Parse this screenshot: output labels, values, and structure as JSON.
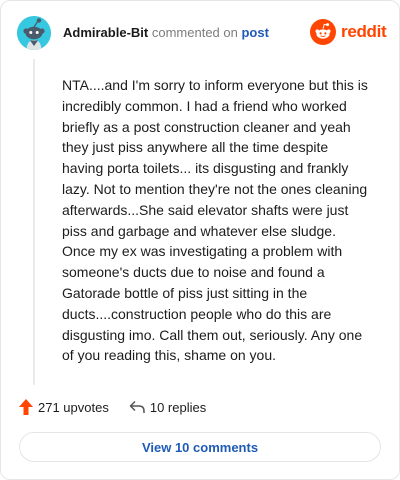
{
  "comment": {
    "author": "Admirable-Bit",
    "action_text": "commented on",
    "post_link": "post",
    "body_lines": [
      "NTA....and I'm sorry to inform everyone but this is",
      "incredibly common. I had a friend who worked",
      "briefly as a post construction cleaner and yeah",
      "they just piss anywhere all the time despite",
      "having porta toilets... its disgusting and frankly",
      "lazy. Not to mention they're not the ones cleaning",
      "afterwards...She said elevator shafts were just",
      "piss and garbage and whatever else sludge.",
      "Once my ex was investigating a problem with",
      "someone's ducts due to noise and found a",
      "Gatorade bottle of piss just sitting in the",
      "ducts....construction people who do this are",
      "disgusting imo. Call them out, seriously. Any one",
      "of you reading this, shame on you."
    ]
  },
  "brand": {
    "name": "reddit",
    "color": "#ff4500"
  },
  "actions": {
    "upvotes": "271 upvotes",
    "replies": "10 replies"
  },
  "view_comments_label": "View 10 comments",
  "icons": {
    "avatar": "snoo-avatar-icon",
    "logo": "reddit-logo-icon",
    "upvote": "upvote-arrow-icon",
    "reply": "reply-arrow-icon"
  },
  "colors": {
    "accent": "#ff4500",
    "link": "#1f5bb6",
    "avatar_bg": "#35c8e0"
  }
}
